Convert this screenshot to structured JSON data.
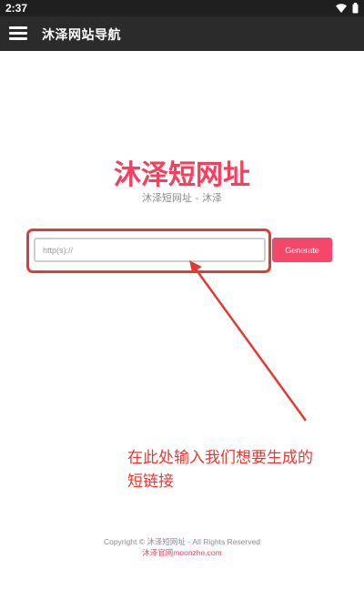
{
  "status_bar": {
    "time": "2:37",
    "icons": [
      "wifi-icon",
      "battery-icon"
    ]
  },
  "app_bar": {
    "title": "沐泽网站导航",
    "menu_icon": "hamburger-menu-icon"
  },
  "main": {
    "title": "沐泽短网址",
    "subtitle": "沐泽短网址 - 沐泽",
    "url_input": {
      "placeholder": "http(s)://",
      "value": ""
    },
    "generate_label": "Generate"
  },
  "annotation": {
    "line1": "在此处输入我们想要生成的",
    "line2": "短链接"
  },
  "footer": {
    "copyright": "Copyright © 沐泽短网址 - All Rights Reserved",
    "link": "沐泽官网moonzhe.com"
  },
  "colors": {
    "accent": "#f4405e",
    "button": "#f4476a",
    "annotation": "#e53935",
    "app_bar": "#2b2b2b",
    "status_bar": "#1f1f1f"
  }
}
